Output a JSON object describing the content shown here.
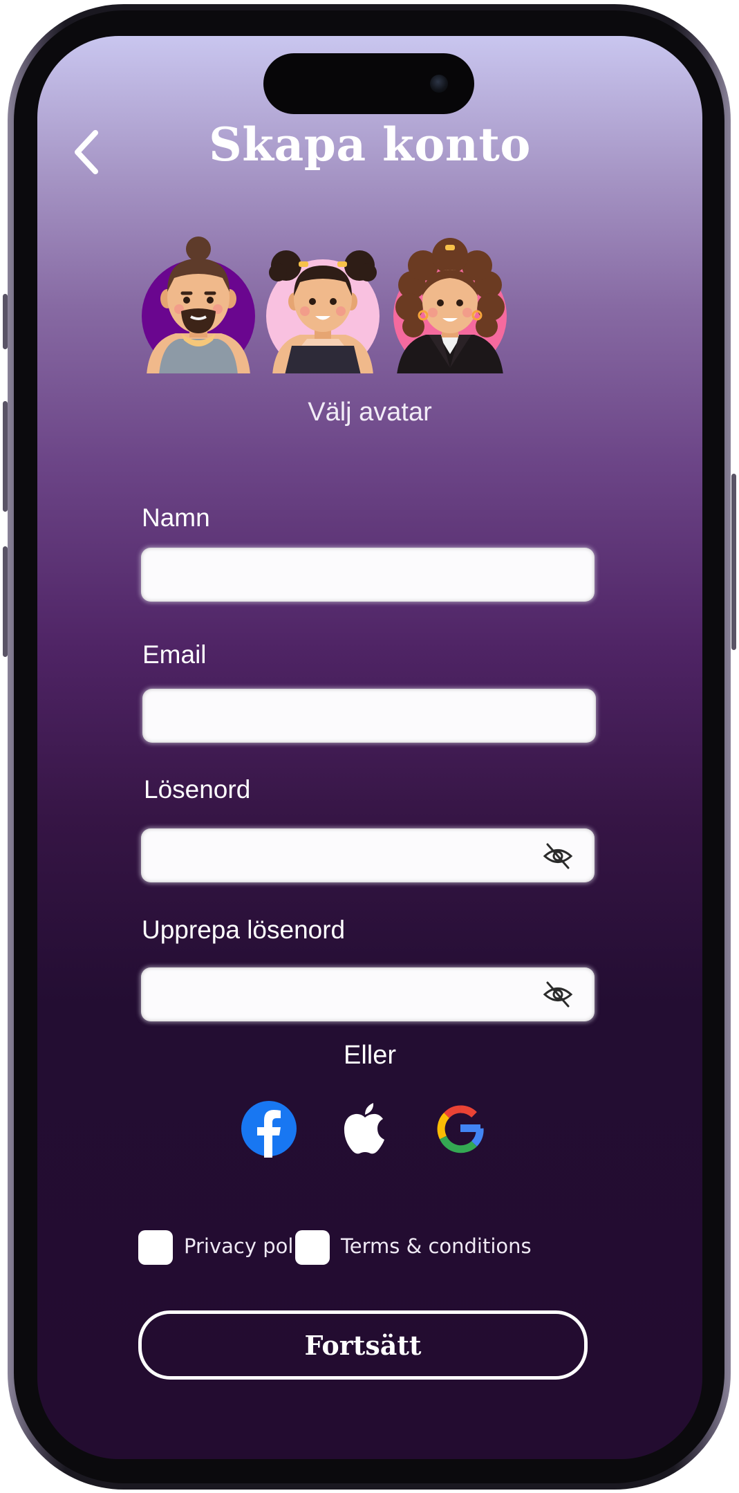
{
  "header": {
    "title": "Skapa konto",
    "back_icon": "chevron-left-icon"
  },
  "avatars": {
    "caption": "Välj avatar",
    "options": [
      {
        "name": "avatar-man-bun",
        "bg_color": "#6a068f"
      },
      {
        "name": "avatar-girl-buns",
        "bg_color": "#f9c1e0"
      },
      {
        "name": "avatar-woman-curly",
        "bg_color": "#f56a9e"
      }
    ]
  },
  "form": {
    "name_label": "Namn",
    "email_label": "Email",
    "password_label": "Lösenord",
    "repeat_password_label": "Upprepa lösenord",
    "name_value": "",
    "email_value": "",
    "password_value": "",
    "repeat_password_value": "",
    "toggle_icon": "eye-slash-icon"
  },
  "social": {
    "divider_text": "Eller",
    "providers": [
      {
        "name": "facebook",
        "icon": "facebook-icon",
        "color": "#1877f2"
      },
      {
        "name": "apple",
        "icon": "apple-icon",
        "color": "#ffffff"
      },
      {
        "name": "google",
        "icon": "google-icon",
        "color": "#4285f4"
      }
    ]
  },
  "consents": {
    "privacy_label": "Privacy policy",
    "terms_label": "Terms & conditions",
    "privacy_checked": false,
    "terms_checked": false
  },
  "actions": {
    "continue_label": "Fortsätt"
  },
  "theme": {
    "gradient_top": "#c9c6ef",
    "gradient_bottom": "#230c30",
    "text": "#ffffff"
  }
}
